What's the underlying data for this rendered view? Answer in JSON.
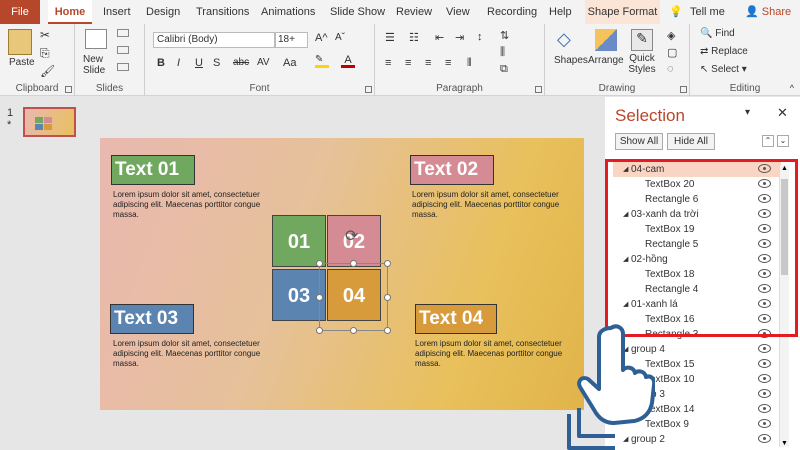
{
  "tabs": [
    "File",
    "Home",
    "Insert",
    "Design",
    "Transitions",
    "Animations",
    "Slide Show",
    "Review",
    "View",
    "Recording",
    "Help",
    "Shape Format",
    "Tell me",
    "Share"
  ],
  "ribbon": {
    "clipboard": "Clipboard",
    "paste": "Paste",
    "slides": "Slides",
    "new_slide": "New Slide",
    "font": "Font",
    "font_name": "Calibri (Body)",
    "font_size": "18+",
    "paragraph": "Paragraph",
    "drawing": "Drawing",
    "shapes": "Shapes",
    "arrange": "Arrange",
    "quick_styles": "Quick Styles",
    "editing": "Editing",
    "find": "Find",
    "replace": "Replace",
    "select": "Select"
  },
  "thumb": {
    "number": "1",
    "star": "*"
  },
  "slide": {
    "t1": "Text 01",
    "t2": "Text 02",
    "t3": "Text 03",
    "t4": "Text 04",
    "lorem": "Lorem ipsum dolor sit amet, consectetuer adipiscing elit. Maecenas porttitor congue massa.",
    "n1": "01",
    "n2": "02",
    "n3": "03",
    "n4": "04"
  },
  "pane": {
    "title": "Selection",
    "show_all": "Show All",
    "hide_all": "Hide All",
    "items": [
      {
        "label": "04-cam",
        "level": 0,
        "group": true
      },
      {
        "label": "TextBox 20",
        "level": 1
      },
      {
        "label": "Rectangle 6",
        "level": 1
      },
      {
        "label": "03-xanh da trời",
        "level": 0,
        "group": true
      },
      {
        "label": "TextBox 19",
        "level": 1
      },
      {
        "label": "Rectangle 5",
        "level": 1
      },
      {
        "label": "02-hồng",
        "level": 0,
        "group": true
      },
      {
        "label": "TextBox 18",
        "level": 1
      },
      {
        "label": "Rectangle 4",
        "level": 1
      },
      {
        "label": "01-xanh lá",
        "level": 0,
        "group": true
      },
      {
        "label": "TextBox 16",
        "level": 1
      },
      {
        "label": "Rectangle 3",
        "level": 1
      },
      {
        "label": "group 4",
        "level": 0,
        "group": true
      },
      {
        "label": "TextBox 15",
        "level": 1
      },
      {
        "label": "TextBox 10",
        "level": 1
      },
      {
        "label": "group 3",
        "level": 0,
        "group": true
      },
      {
        "label": "TextBox 14",
        "level": 1
      },
      {
        "label": "TextBox 9",
        "level": 1
      },
      {
        "label": "group 2",
        "level": 0,
        "group": true
      }
    ]
  },
  "colors": {
    "accent": "#b7472a",
    "highlight": "#e31b23",
    "selected_row": "#fbd5c3",
    "green": "#70a860",
    "pink": "#d58b93",
    "blue": "#5b84b1",
    "orange": "#d79b3b"
  }
}
